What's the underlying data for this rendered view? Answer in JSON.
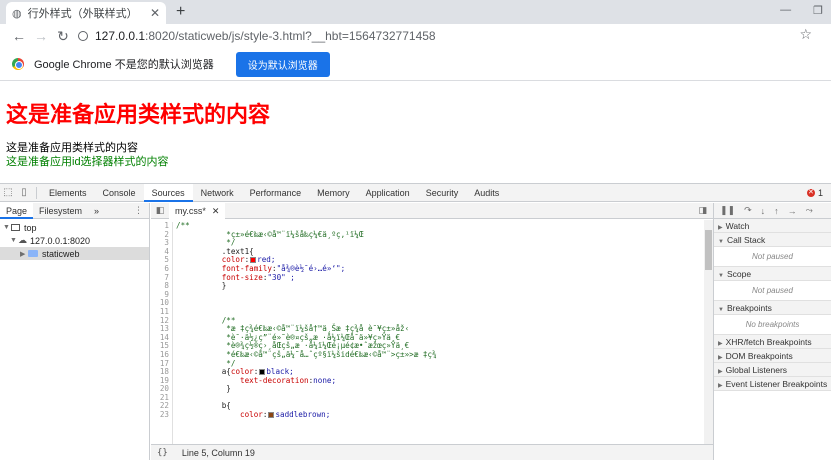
{
  "browser": {
    "tab_title": "行外样式（外联样式）",
    "url_host": "127.0.0.1",
    "url_rest": ":8020/staticweb/js/style-3.html?__hbt=1564732771458"
  },
  "infobar": {
    "message": "Google Chrome 不是您的默认浏览器",
    "button": "设为默认浏览器"
  },
  "page": {
    "heading": "这是准备应用类样式的内容",
    "para1": "这是准备应用类样式的内容",
    "para2": "这是准备应用id选择器样式的内容"
  },
  "devtools": {
    "tabs": [
      "Elements",
      "Console",
      "Sources",
      "Network",
      "Performance",
      "Memory",
      "Application",
      "Security",
      "Audits"
    ],
    "active_tab": "Sources",
    "error_count": "1",
    "navigator": {
      "tabs": [
        "Page",
        "Filesystem"
      ],
      "more": "»",
      "tree": {
        "top": "top",
        "host": "127.0.0.1:8020",
        "folder": "staticweb"
      }
    },
    "editor": {
      "file_tab": "my.css*",
      "line_numbers": [
        "1",
        "2",
        "3",
        "4",
        "5",
        "6",
        "7",
        "8",
        "9",
        "10",
        "11",
        "12",
        "13",
        "14",
        "15",
        "16",
        "17",
        "18",
        "19",
        "20",
        "21",
        "22",
        "23"
      ],
      "code": {
        "l1": "/**",
        "l2": "           *ç±»é€‰æ‹©å™¨ï¼šå‰ç¼€ä¸ºç‚¹ï¼Œ",
        "l3": "           */",
        "l4": "          .text1{",
        "l5_prop": "color",
        "l5_val": "red;",
        "l6_prop": "font-family",
        "l6_val": "\"å¾®è½¯é›…é»‘\";",
        "l7_prop": "font-size",
        "l7_val": "\"30\" ;",
        "l8": "          }",
        "l12": "          /**",
        "l13": "           *æ ‡ç­¾é€‰æ‹©å™¨ï¼šå†™ä¸Šæ ‡ç­¾å è¯¥ç±»åž‹",
        "l14": "           *è¯·ä½¿ç”¨é»˜è®¤çš„æ ·å¼ï¼Œå¯ä»¥ç»Ÿä¸€",
        "l15": "           *è®¾ç½®ç›¸åŒçš„æ ·å¼ï¼Œé¡µé¢æ•ˆæžœç»Ÿä¸€",
        "l16": "           *é€‰æ‹©å™¨çš„ä¼˜å…ˆçº§ï¼šidé€‰æ‹©å™¨>ç±»>æ ‡ç­¾",
        "l17": "           */",
        "l18_a": "          a{",
        "l18_prop": "color",
        "l18_val": "black;",
        "l19_prop": "text-decoration",
        "l19_val": "none;",
        "l20": "           }",
        "l22": "          b{",
        "l23_prop": "color",
        "l23_val": "saddlebrown;"
      },
      "status": "Line 5, Column 19",
      "status_brace": "{}"
    },
    "debugger": {
      "watch": "Watch",
      "call_stack": "Call Stack",
      "not_paused_1": "Not paused",
      "scope": "Scope",
      "not_paused_2": "Not paused",
      "breakpoints": "Breakpoints",
      "no_breakpoints": "No breakpoints",
      "xhr": "XHR/fetch Breakpoints",
      "dom": "DOM Breakpoints",
      "global": "Global Listeners",
      "event": "Event Listener Breakpoints"
    }
  },
  "colors": {
    "heading": "#ff0000",
    "para2": "#008000",
    "button": "#1a73e8",
    "swatch_red": "#ff0000",
    "swatch_black": "#000000",
    "swatch_saddlebrown": "#8b4513"
  }
}
